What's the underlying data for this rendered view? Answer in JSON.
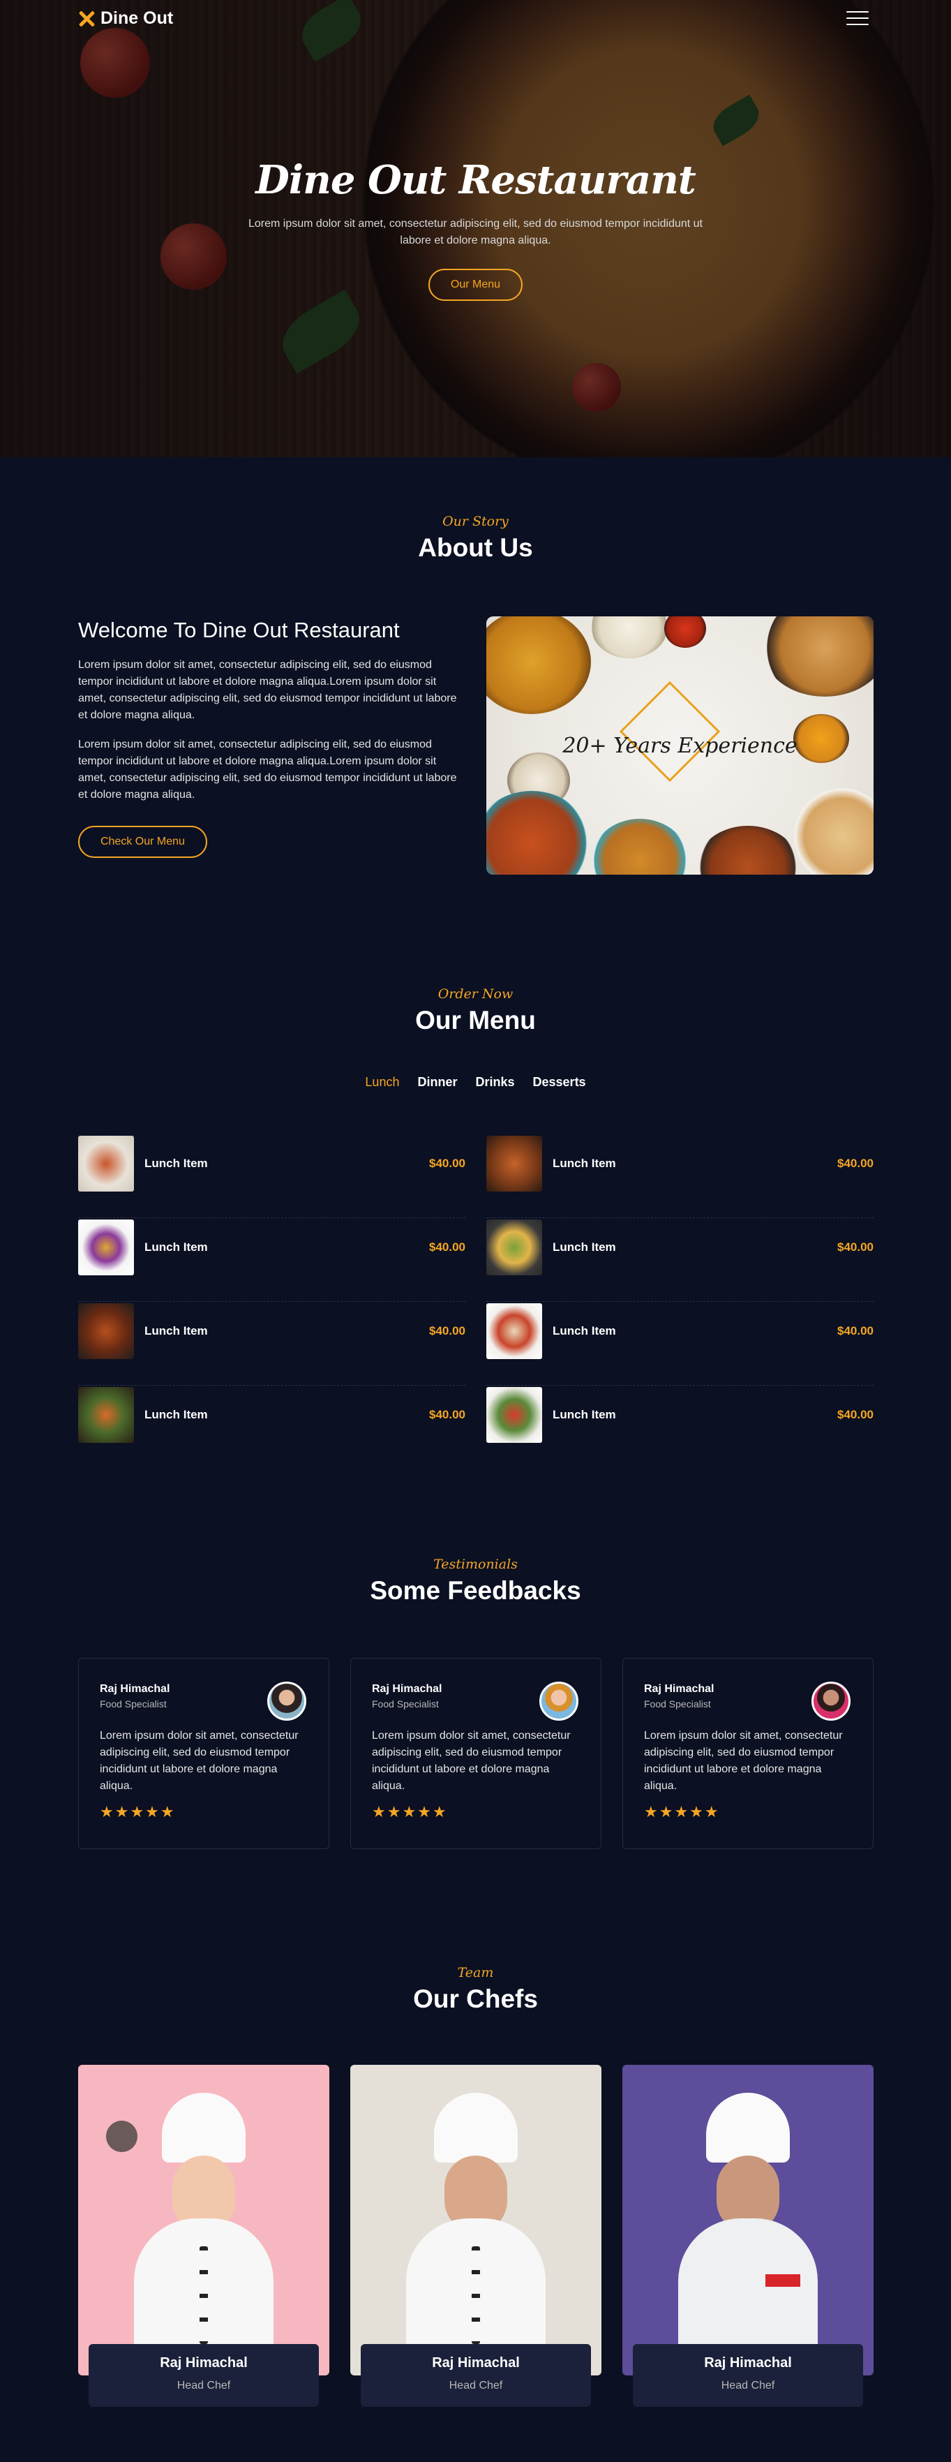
{
  "nav": {
    "brand": "Dine Out",
    "icons": {
      "logo": "crossed-utensils-icon",
      "menu": "hamburger-menu-icon"
    }
  },
  "hero": {
    "title": "Dine Out Restaurant",
    "text": "Lorem ipsum dolor sit amet, consectetur adipiscing elit, sed do eiusmod tempor incididunt ut labore et dolore magna aliqua.",
    "button": "Our Menu"
  },
  "about": {
    "kicker": "Our Story",
    "title": "About Us",
    "heading": "Welcome To Dine Out Restaurant",
    "paragraph1": "Lorem ipsum dolor sit amet, consectetur adipiscing elit, sed do eiusmod tempor incididunt ut labore et dolore magna aliqua.Lorem ipsum dolor sit amet, consectetur adipiscing elit, sed do eiusmod tempor incididunt ut labore et dolore magna aliqua.",
    "paragraph2": "Lorem ipsum dolor sit amet, consectetur adipiscing elit, sed do eiusmod tempor incididunt ut labore et dolore magna aliqua.Lorem ipsum dolor sit amet, consectetur adipiscing elit, sed do eiusmod tempor incididunt ut labore et dolore magna aliqua.",
    "button": "Check Our Menu",
    "badge": "20+ Years Experience"
  },
  "menu": {
    "kicker": "Order Now",
    "title": "Our Menu",
    "tabs": [
      "Lunch",
      "Dinner",
      "Drinks",
      "Desserts"
    ],
    "active_tab": "Lunch",
    "items": [
      {
        "name": "Lunch Item",
        "price": "$40.00"
      },
      {
        "name": "Lunch Item",
        "price": "$40.00"
      },
      {
        "name": "Lunch Item",
        "price": "$40.00"
      },
      {
        "name": "Lunch Item",
        "price": "$40.00"
      },
      {
        "name": "Lunch Item",
        "price": "$40.00"
      },
      {
        "name": "Lunch Item",
        "price": "$40.00"
      },
      {
        "name": "Lunch Item",
        "price": "$40.00"
      },
      {
        "name": "Lunch Item",
        "price": "$40.00"
      }
    ]
  },
  "testimonials": {
    "kicker": "Testimonials",
    "title": "Some Feedbacks",
    "items": [
      {
        "name": "Raj Himachal",
        "role": "Food Specialist",
        "text": "Lorem ipsum dolor sit amet, consectetur adipiscing elit, sed do eiusmod tempor incididunt ut labore et dolore magna aliqua.",
        "stars": "★★★★★"
      },
      {
        "name": "Raj Himachal",
        "role": "Food Specialist",
        "text": "Lorem ipsum dolor sit amet, consectetur adipiscing elit, sed do eiusmod tempor incididunt ut labore et dolore magna aliqua.",
        "stars": "★★★★★"
      },
      {
        "name": "Raj Himachal",
        "role": "Food Specialist",
        "text": "Lorem ipsum dolor sit amet, consectetur adipiscing elit, sed do eiusmod tempor incididunt ut labore et dolore magna aliqua.",
        "stars": "★★★★★"
      }
    ]
  },
  "chefs": {
    "kicker": "Team",
    "title": "Our Chefs",
    "items": [
      {
        "name": "Raj Himachal",
        "role": "Head Chef"
      },
      {
        "name": "Raj Himachal",
        "role": "Head Chef"
      },
      {
        "name": "Raj Himachal",
        "role": "Head Chef"
      }
    ]
  },
  "colors": {
    "accent": "#f5a623",
    "background": "#0b1022",
    "card": "#1b213a"
  }
}
